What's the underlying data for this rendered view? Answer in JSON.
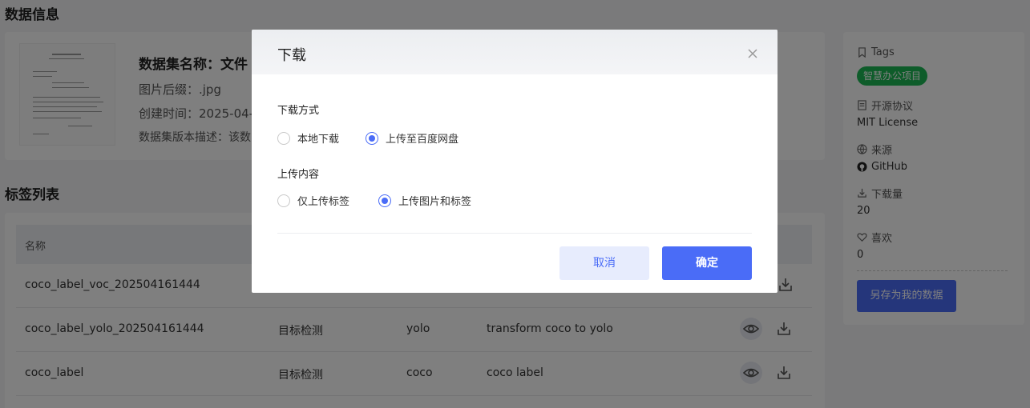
{
  "page": {
    "section_info_title": "数据信息",
    "section_labels_title": "标签列表"
  },
  "dataset": {
    "name": "数据集名称：文件",
    "suffix": "图片后缀：.jpg",
    "created": "创建时间：2025-04-",
    "description": "数据集版本描述：该数"
  },
  "table": {
    "header_name": "名称",
    "rows": [
      {
        "name": "coco_label_voc_202504161444",
        "type": "",
        "format": "",
        "desc": ""
      },
      {
        "name": "coco_label_yolo_202504161444",
        "type": "目标检测",
        "format": "yolo",
        "desc": "transform coco to yolo"
      },
      {
        "name": "coco_label",
        "type": "目标检测",
        "format": "coco",
        "desc": "coco label"
      }
    ]
  },
  "sidebar": {
    "tags_label": "Tags",
    "tag": "智慧办公项目",
    "license_label": "开源协议",
    "license": "MIT License",
    "source_label": "来源",
    "source": "GitHub",
    "downloads_label": "下载量",
    "downloads": "20",
    "likes_label": "喜欢",
    "likes": "0",
    "save_button": "另存为我的数据"
  },
  "modal": {
    "title": "下载",
    "method_label": "下载方式",
    "method_options": [
      "本地下载",
      "上传至百度网盘"
    ],
    "method_selected": "上传至百度网盘",
    "content_label": "上传内容",
    "content_options": [
      "仅上传标签",
      "上传图片和标签"
    ],
    "content_selected": "上传图片和标签",
    "cancel": "取消",
    "ok": "确定"
  },
  "colors": {
    "accent": "#4a6cf7",
    "tag_green": "#1db954",
    "overlay": "rgba(0,0,0,0.5)"
  }
}
